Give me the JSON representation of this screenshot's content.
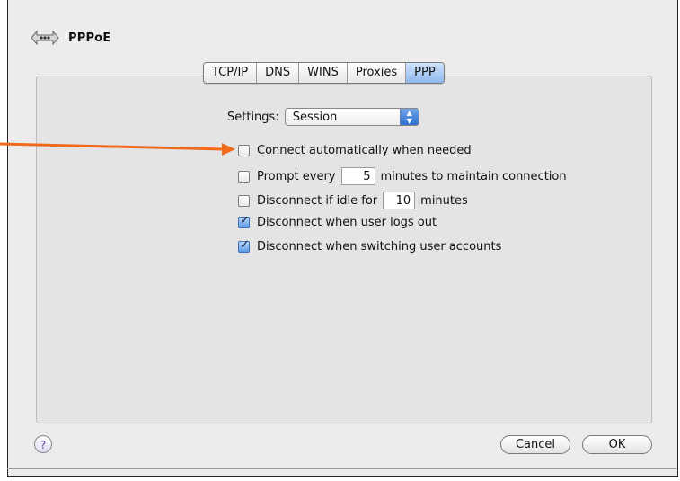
{
  "window": {
    "title": "PPPoE"
  },
  "tabs": [
    "TCP/IP",
    "DNS",
    "WINS",
    "Proxies",
    "PPP"
  ],
  "selected_tab_index": 4,
  "settings": {
    "label": "Settings:",
    "value": "Session"
  },
  "options": [
    {
      "pre": "Connect automatically when needed",
      "checked": false
    },
    {
      "pre": "Prompt every",
      "field": "5",
      "post": "minutes to maintain connection",
      "checked": false
    },
    {
      "pre": "Disconnect if idle for",
      "field": "10",
      "post": "minutes",
      "checked": false
    },
    {
      "pre": "Disconnect when user logs out",
      "checked": true
    },
    {
      "pre": "Disconnect when switching user accounts",
      "checked": true
    }
  ],
  "buttons": {
    "help": "?",
    "cancel": "Cancel",
    "ok": "OK"
  },
  "colors": {
    "annotation_arrow": "#f26b1d",
    "selected_tab": "#8fb8ee"
  },
  "icons": {
    "header": "network-diamond-icon",
    "help": "help-question-icon",
    "popup": "popup-arrows-icon"
  }
}
